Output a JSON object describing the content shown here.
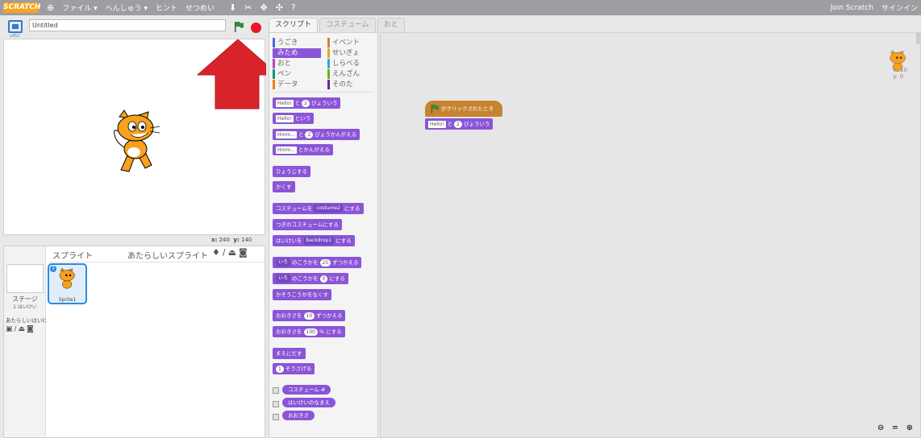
{
  "topbar": {
    "logo": "SCRATCH",
    "menus": [
      "ファイル ▾",
      "へんしゅう ▾",
      "ヒント",
      "せつめい"
    ],
    "join": "Join Scratch",
    "signin": "サインイン"
  },
  "stage": {
    "version": "v452",
    "project_title": "Untitled",
    "x_label": "x:",
    "x_value": "240",
    "y_label": "y:",
    "y_value": "140"
  },
  "sprites": {
    "title": "スプライト",
    "new_sprite": "あたらしいスプライト",
    "stage_label": "ステージ",
    "backdrops_count": "1 はいけい",
    "new_backdrop": "あたらしいはいけい",
    "sprite_name": "Sprite1"
  },
  "tabs": [
    "スクリプト",
    "コスチューム",
    "おと"
  ],
  "categories": {
    "left": [
      "うごき",
      "みため",
      "おと",
      "ペン",
      "データ"
    ],
    "right": [
      "イベント",
      "せいぎょ",
      "しらべる",
      "えんざん",
      "そのた"
    ],
    "colors_left": [
      "#4a6cd4",
      "#8a55d7",
      "#bb42c3",
      "#0e9a6c",
      "#ee7d16"
    ],
    "colors_right": [
      "#c88330",
      "#e1a91a",
      "#2ca5e2",
      "#5cb712",
      "#632d99"
    ]
  },
  "blocks": {
    "say_for": {
      "a": "Hello!",
      "b": "と",
      "c": "2",
      "d": "びょういう"
    },
    "say": {
      "a": "Hello!",
      "b": "という"
    },
    "think_for": {
      "a": "Hmm...",
      "b": "と",
      "c": "2",
      "d": "びょうかんがえる"
    },
    "think": {
      "a": "Hmm...",
      "b": "とかんがえる"
    },
    "show": "ひょうじする",
    "hide": "かくす",
    "switch_costume": {
      "a": "コスチュームを",
      "b": "costume2",
      "c": "にする"
    },
    "next_costume": "つぎのコスチュームにする",
    "switch_backdrop": {
      "a": "はいけいを",
      "b": "backdrop1",
      "c": "にする"
    },
    "change_effect": {
      "a": "いろ",
      "b": "のこうかを",
      "c": "25",
      "d": "ずつかえる"
    },
    "set_effect": {
      "a": "いろ",
      "b": "のこうかを",
      "c": "0",
      "d": "にする"
    },
    "clear_effects": "かそうこうかをなくす",
    "change_size": {
      "a": "おおきさを",
      "b": "10",
      "c": "ずつかえる"
    },
    "set_size": {
      "a": "おおきさを",
      "b": "100",
      "c": "% にする"
    },
    "front": "まえにだす",
    "back_layers": {
      "a": "1",
      "b": "そうさげる"
    },
    "reporters": [
      "コスチューム #",
      "はいけいのなまえ",
      "おおきさ"
    ]
  },
  "script": {
    "hat": "がクリックされたとき",
    "say_a": "Hello!",
    "say_b": "と",
    "say_c": "2",
    "say_d": "びょういう"
  },
  "corner": {
    "x_label": "x: 10",
    "y_label": "y: 0"
  },
  "zoom": "⊖ = ⊕"
}
